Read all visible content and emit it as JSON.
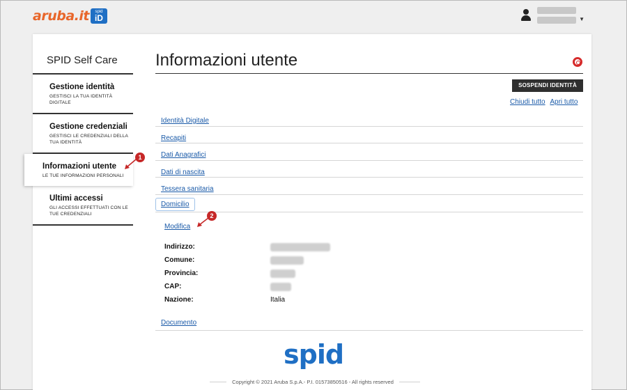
{
  "brand": {
    "name": "aruba.it",
    "badge_top": "spid",
    "badge_main": "iD"
  },
  "sidebar": {
    "title": "SPID Self Care",
    "items": [
      {
        "title": "Gestione identità",
        "subtitle": "GESTISCI LA TUA IDENTITÀ DIGITALE"
      },
      {
        "title": "Gestione credenziali",
        "subtitle": "GESTISCI LE CREDENZIALI DELLA TUA IDENTITÀ"
      },
      {
        "title": "Informazioni utente",
        "subtitle": "LE TUE INFORMAZIONI PERSONALI"
      },
      {
        "title": "Ultimi accessi",
        "subtitle": "GLI ACCESSI EFFETTUATI CON LE TUE CREDENZIALI"
      }
    ]
  },
  "main": {
    "title": "Informazioni utente",
    "suspend_button": "SOSPENDI IDENTITÀ",
    "collapse_all": "Chiudi tutto",
    "expand_all": "Apri tutto",
    "sections": [
      "Identità Digitale",
      "Recapiti",
      "Dati Anagrafici",
      "Dati di nascita",
      "Tessera sanitaria",
      "Domicilio"
    ],
    "edit_link": "Modifica",
    "details": [
      {
        "label": "Indirizzo:",
        "value": ""
      },
      {
        "label": "Comune:",
        "value": ""
      },
      {
        "label": "Provincia:",
        "value": ""
      },
      {
        "label": "CAP:",
        "value": ""
      },
      {
        "label": "Nazione:",
        "value": "Italia"
      }
    ],
    "document_section": "Documento"
  },
  "markers": [
    "1",
    "2"
  ],
  "footer": {
    "logo": "spid",
    "copyright": "Copyright © 2021 Aruba S.p.A.- P.I. 01573850516 - All rights reserved"
  },
  "colors": {
    "accent": "#1a5aa8",
    "brand_orange": "#e8662a",
    "spid_blue": "#1f6fc4",
    "marker_red": "#c62828"
  }
}
